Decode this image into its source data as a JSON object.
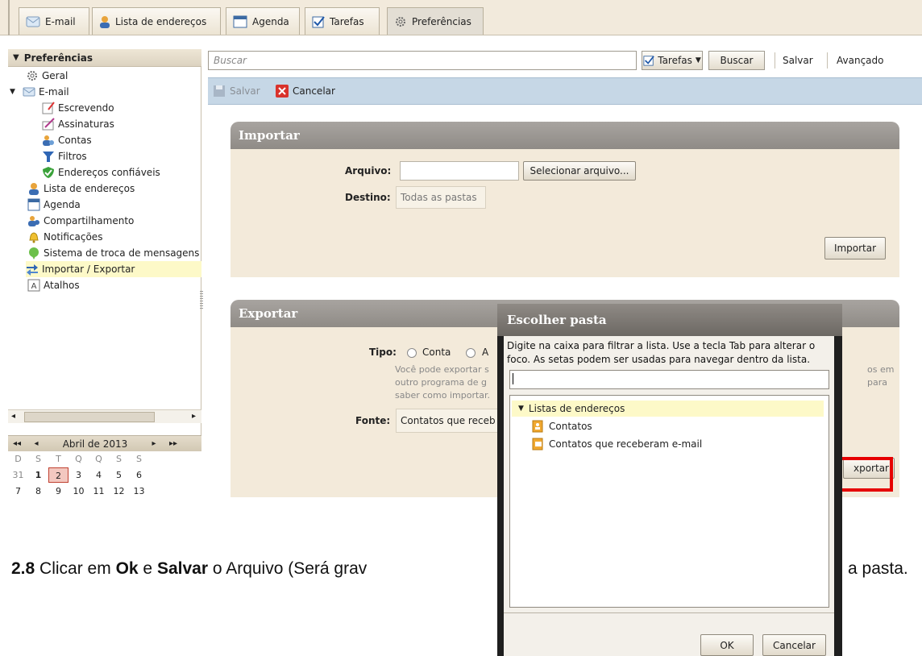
{
  "tabs": [
    {
      "label": "E-mail",
      "icon": "email-icon"
    },
    {
      "label": "Lista de endereços",
      "icon": "contacts-icon"
    },
    {
      "label": "Agenda",
      "icon": "calendar-icon"
    },
    {
      "label": "Tarefas",
      "icon": "tasks-icon"
    },
    {
      "label": "Preferências",
      "icon": "gear-icon",
      "active": true
    }
  ],
  "sidebar": {
    "header": "Preferências",
    "items": [
      {
        "label": "Geral",
        "icon": "gear-icon"
      },
      {
        "label": "E-mail",
        "icon": "email-icon"
      },
      {
        "label": "Escrevendo",
        "icon": "compose-icon"
      },
      {
        "label": "Assinaturas",
        "icon": "signature-icon"
      },
      {
        "label": "Contas",
        "icon": "accounts-icon"
      },
      {
        "label": "Filtros",
        "icon": "filter-icon"
      },
      {
        "label": "Endereços confiáveis",
        "icon": "shield-icon"
      },
      {
        "label": "Lista de endereços",
        "icon": "contacts-icon"
      },
      {
        "label": "Agenda",
        "icon": "calendar-icon"
      },
      {
        "label": "Compartilhamento",
        "icon": "sharing-icon"
      },
      {
        "label": "Notificações",
        "icon": "bell-icon"
      },
      {
        "label": "Sistema de troca de mensagens",
        "icon": "chat-icon"
      },
      {
        "label": "Importar / Exportar",
        "icon": "import-export-icon",
        "selected": true
      },
      {
        "label": "Atalhos",
        "icon": "shortcut-icon"
      }
    ]
  },
  "calendar": {
    "month": "Abril de 2013",
    "nav": {
      "prev_year": "◂◂",
      "prev_month": "◂",
      "next_month": "▸",
      "next_year": "▸▸"
    },
    "weekdays": [
      "D",
      "S",
      "T",
      "Q",
      "Q",
      "S",
      "S"
    ],
    "weeks": [
      [
        "31",
        "1",
        "2",
        "3",
        "4",
        "5",
        "6"
      ],
      [
        "7",
        "8",
        "9",
        "10",
        "11",
        "12",
        "13"
      ]
    ],
    "today": "2",
    "bold_day": "1"
  },
  "toolbar": {
    "search_placeholder": "Buscar",
    "scope_label": "Tarefas",
    "search_button": "Buscar",
    "save_link": "Salvar",
    "advanced_link": "Avançado"
  },
  "actions": {
    "save": "Salvar",
    "cancel": "Cancelar"
  },
  "import_panel": {
    "title": "Importar",
    "file_label": "Arquivo:",
    "file_button": "Selecionar arquivo...",
    "dest_label": "Destino:",
    "dest_value": "Todas as pastas",
    "import_button": "Importar"
  },
  "export_panel": {
    "title": "Exportar",
    "type_label": "Tipo:",
    "type_option1": "Conta",
    "type_option2": "A",
    "desc_line1": "Você pode exportar s",
    "desc_line2": "outro programa de g",
    "desc_line3": "saber como importar.",
    "desc_right1": "os em",
    "desc_right2": "para",
    "source_label": "Fonte:",
    "source_value": "Contatos que receb",
    "export_button": "xportar"
  },
  "dialog": {
    "title": "Escolher pasta",
    "hint": "Digite na caixa para filtrar a lista. Use a tecla Tab para alterar o foco. As setas podem ser usadas para navegar dentro da lista.",
    "filter_value": "",
    "root": "Listas de endereços",
    "children": [
      "Contatos",
      "Contatos que receberam e-mail"
    ],
    "ok": "OK",
    "cancel": "Cancelar"
  },
  "caption": {
    "step": "2.8",
    "t1": " Clicar em ",
    "b1": "Ok",
    "t2": " e ",
    "b2": "Salvar",
    "t3": " o Arquivo (Será grav",
    "t4": "a pasta."
  },
  "colors": {
    "highlight": "#e60000",
    "selected_row": "#fdf9c8",
    "panel_bg": "#f3eada",
    "actionbar": "#c6d7e6"
  }
}
